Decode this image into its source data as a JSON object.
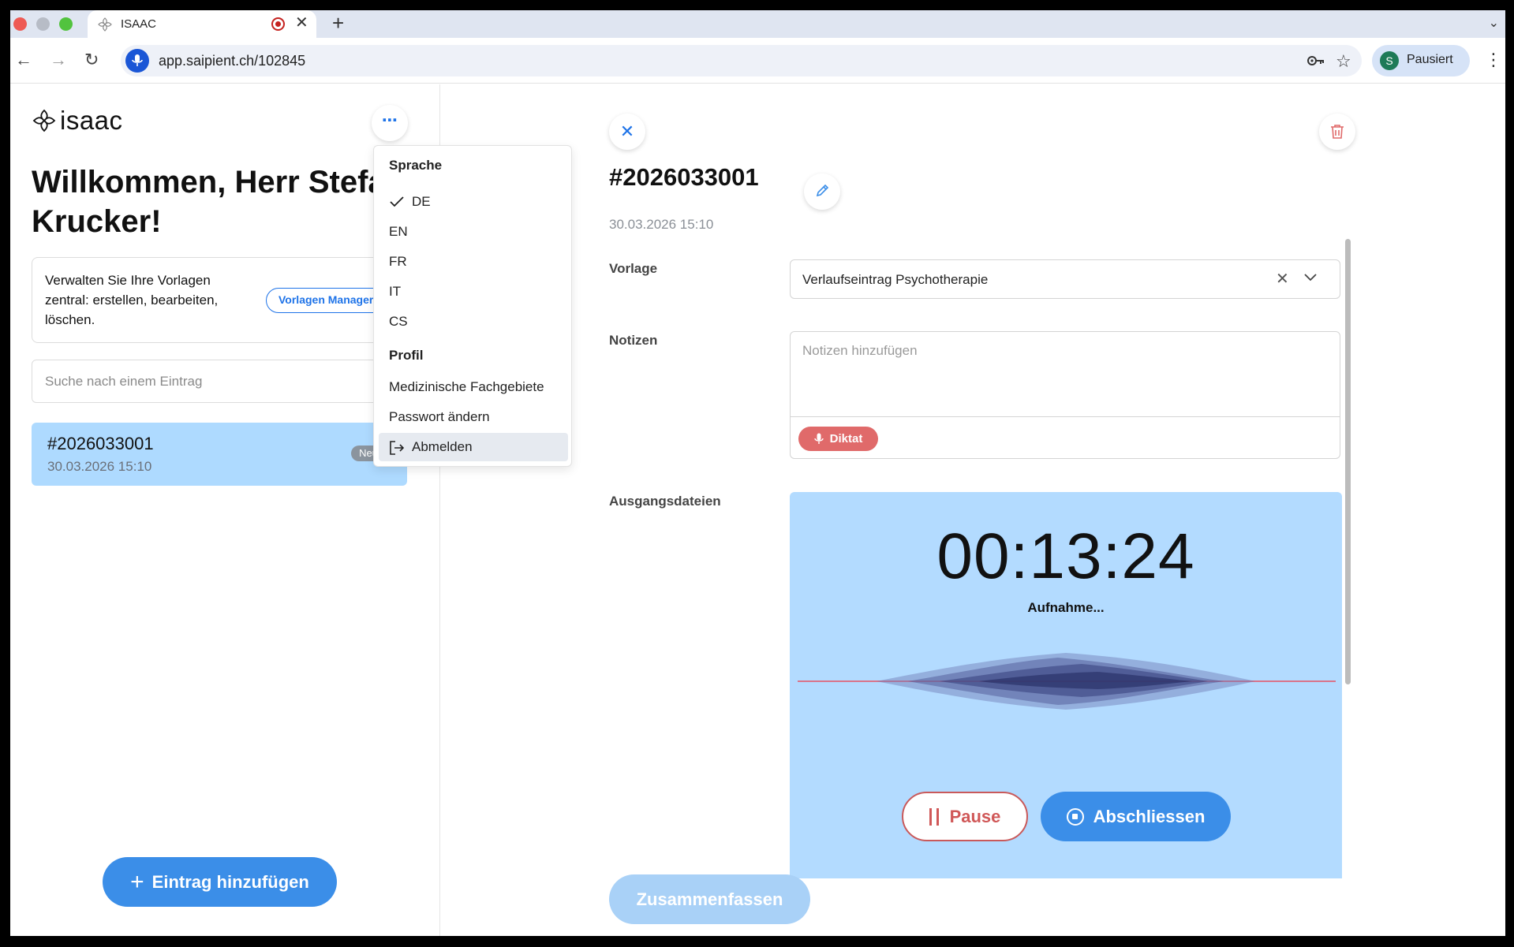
{
  "browser": {
    "tab_title": "ISAAC",
    "url": "app.saipient.ch/102845",
    "profile_initial": "S",
    "profile_label": "Pausiert"
  },
  "sidebar": {
    "logo_text": "isaac",
    "welcome": "Willkommen, Herr Stefan Krucker!",
    "templates_text": "Verwalten Sie Ihre Vorlagen zentral: erstellen, bearbeiten, löschen.",
    "templates_button": "Vorlagen Manager",
    "search_placeholder": "Suche nach einem Eintrag",
    "entries": [
      {
        "id": "#2026033001",
        "date": "30.03.2026 15:10",
        "badge": "Neu"
      }
    ],
    "add_button": "Eintrag hinzufügen"
  },
  "menu": {
    "language_heading": "Sprache",
    "languages": [
      "DE",
      "EN",
      "FR",
      "IT",
      "CS"
    ],
    "selected_language": "DE",
    "profile_heading": "Profil",
    "profile_items": [
      "Medizinische Fachgebiete",
      "Passwort ändern"
    ],
    "logout": "Abmelden"
  },
  "record": {
    "title": "#2026033001",
    "date": "30.03.2026 15:10",
    "template_label": "Vorlage",
    "template_value": "Verlaufseintrag Psychotherapie",
    "notes_label": "Notizen",
    "notes_placeholder": "Notizen hinzufügen",
    "dictate_button": "Diktat",
    "output_label": "Ausgangsdateien",
    "timer": "00:13:24",
    "status": "Aufnahme...",
    "pause_button": "Pause",
    "finish_button": "Abschliessen",
    "summarize_button": "Zusammenfassen"
  },
  "colors": {
    "accent": "#3b8ee8",
    "selected_entry": "#aedaff",
    "recorder_bg": "#b3dbff",
    "danger": "#d05858"
  }
}
